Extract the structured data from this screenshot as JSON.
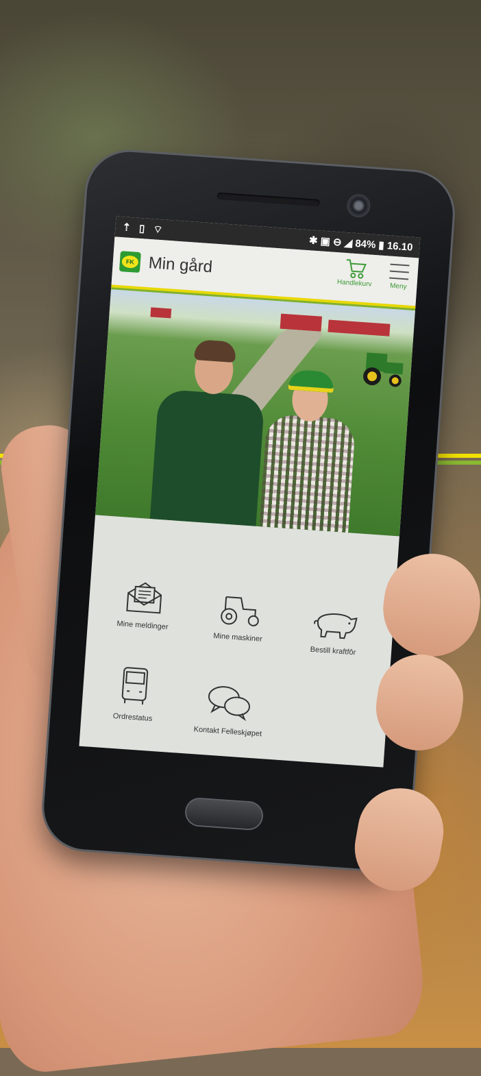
{
  "status_bar": {
    "battery": "84%",
    "time": "16.10"
  },
  "app_bar": {
    "logo_text": "FK",
    "title": "Min gård",
    "cart_label": "Handlekurv",
    "menu_label": "Meny"
  },
  "menu_items": [
    {
      "label": "Mine meldinger",
      "icon": "envelope-icon"
    },
    {
      "label": "Mine maskiner",
      "icon": "tractor-icon"
    },
    {
      "label": "Bestill kraftfôr",
      "icon": "pig-icon"
    },
    {
      "label": "Ordrestatus",
      "icon": "truck-icon"
    },
    {
      "label": "Kontakt Felleskjøpet",
      "icon": "chat-bubbles-icon"
    }
  ],
  "colors": {
    "brand_green": "#2d9b32",
    "brand_yellow": "#f0e31a",
    "accent_green": "#3c9a38"
  }
}
